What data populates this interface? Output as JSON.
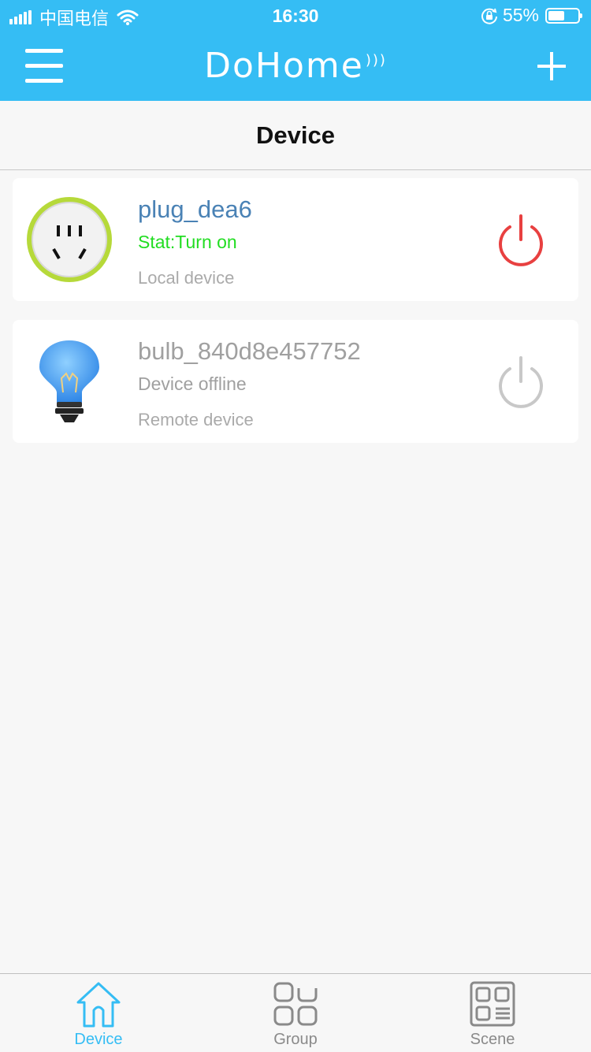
{
  "status_bar": {
    "carrier": "中国电信",
    "time": "16:30",
    "battery": "55%",
    "battery_level": 0.55
  },
  "app_bar": {
    "logo": "DoHome",
    "menu_icon": "hamburger-icon",
    "add_icon": "plus-icon"
  },
  "page": {
    "title": "Device"
  },
  "devices": [
    {
      "name": "plug_dea6",
      "status": "Stat:Turn on",
      "location": "Local device",
      "icon": "plug-icon",
      "power": "on",
      "name_color": "#4a82b5",
      "status_color": "#22dd22",
      "power_color": "#e84040"
    },
    {
      "name": "bulb_840d8e457752",
      "status": "Device offline",
      "location": "Remote device",
      "icon": "bulb-icon",
      "power": "offline",
      "name_color": "#a0a0a0",
      "status_color": "#a0a0a0",
      "power_color": "#c8c8c8"
    }
  ],
  "tabs": [
    {
      "label": "Device",
      "icon": "home-icon",
      "active": true
    },
    {
      "label": "Group",
      "icon": "group-icon",
      "active": false
    },
    {
      "label": "Scene",
      "icon": "scene-icon",
      "active": false
    }
  ],
  "colors": {
    "primary": "#35bdf4",
    "tab_active": "#35bdf4",
    "tab_inactive": "#8a8a8a"
  }
}
